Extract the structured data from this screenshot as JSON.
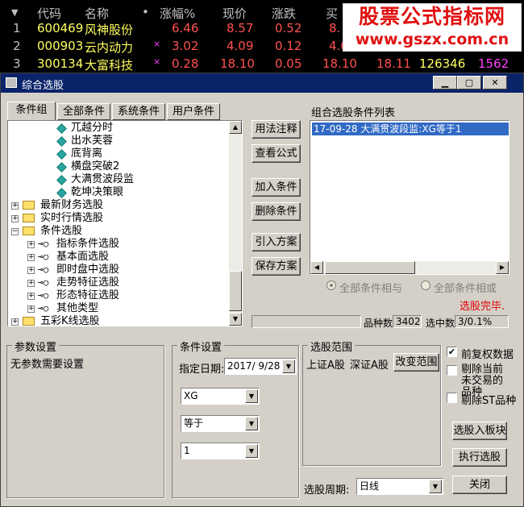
{
  "quote": {
    "headers": [
      "代码",
      "名称",
      "•",
      "涨幅%",
      "现价",
      "涨跌",
      "买"
    ],
    "rows": [
      {
        "idx": "1",
        "code": "600469",
        "name": "风神股份",
        "flag": "",
        "pct": "6.46",
        "price": "8.57",
        "chg": "0.52",
        "buy": "8."
      },
      {
        "idx": "2",
        "code": "000903",
        "name": "云内动力",
        "flag": "×",
        "pct": "3.02",
        "price": "4.09",
        "chg": "0.12",
        "buy": "4.0"
      },
      {
        "idx": "3",
        "code": "300134",
        "name": "大富科技",
        "flag": "×",
        "pct": "0.28",
        "price": "18.10",
        "chg": "0.05",
        "buy": "18.10",
        "sell": "18.11",
        "vol": "126346",
        "extra": "1562"
      }
    ],
    "colors": {
      "up": "#ff5050",
      "code": "#ffff60",
      "name": "#ffff60"
    }
  },
  "logo": {
    "line1": "股票公式指标网",
    "line2": "www.gszx.com.cn"
  },
  "window": {
    "title": "综合选股",
    "tabs": [
      "条件组",
      "全部条件",
      "系统条件",
      "用户条件"
    ],
    "tree": [
      {
        "label": "兀越分时",
        "icon": "diamond-icon"
      },
      {
        "label": "出水芙蓉",
        "icon": "diamond-icon"
      },
      {
        "label": "底背离",
        "icon": "diamond-icon"
      },
      {
        "label": "横盘突破2",
        "icon": "diamond-icon"
      },
      {
        "label": "大满贯波段监",
        "icon": "diamond-icon"
      },
      {
        "label": "乾坤决策眼",
        "icon": "diamond-icon"
      },
      {
        "label": "最新财务选股",
        "icon": "folder-icon"
      },
      {
        "label": "实时行情选股",
        "icon": "folder-icon"
      },
      {
        "label": "条件选股",
        "icon": "folder-icon"
      },
      {
        "label": "指标条件选股",
        "icon": "key-icon"
      },
      {
        "label": "基本面选股",
        "icon": "key-icon"
      },
      {
        "label": "即时盘中选股",
        "icon": "key-icon"
      },
      {
        "label": "走势特征选股",
        "icon": "key-icon"
      },
      {
        "label": "形态特征选股",
        "icon": "key-icon"
      },
      {
        "label": "其他类型",
        "icon": "key-icon"
      },
      {
        "label": "五彩K线选股",
        "icon": "folder-icon"
      }
    ],
    "buttons": {
      "usage": "用法注释",
      "formula": "查看公式",
      "add": "加入条件",
      "del": "删除条件",
      "load": "引入方案",
      "save": "保存方案",
      "range": "改变范围",
      "to_block": "选股入板块",
      "exec": "执行选股",
      "close": "关闭"
    },
    "list_title": "组合选股条件列表",
    "list_items": [
      "17-09-28 大满贯波段监:XG等于1"
    ],
    "radio_and": "全部条件相与",
    "radio_or": "全部条件相或",
    "status": "选股完毕.",
    "count_label": "品种数",
    "count_value": "3402",
    "selected_label": "选中数",
    "selected_value": "3/0.1%",
    "params_title": "参数设置",
    "params_text": "无参数需要设置",
    "cond_title": "条件设置",
    "date_label": "指定日期:",
    "date_value": "2017/ 9/28",
    "combo1": "XG",
    "combo2": "等于",
    "combo3": "1",
    "scope_title": "选股范围",
    "scope_text1": "上证A股",
    "scope_text2": "深证A股",
    "chk_fq": "前复权数据",
    "chk_fq_checked": "✔",
    "chk_stop": "剔除当前未交易的品种",
    "chk_st": "剔除ST品种",
    "period_label": "选股周期:",
    "period_value": "日线"
  }
}
